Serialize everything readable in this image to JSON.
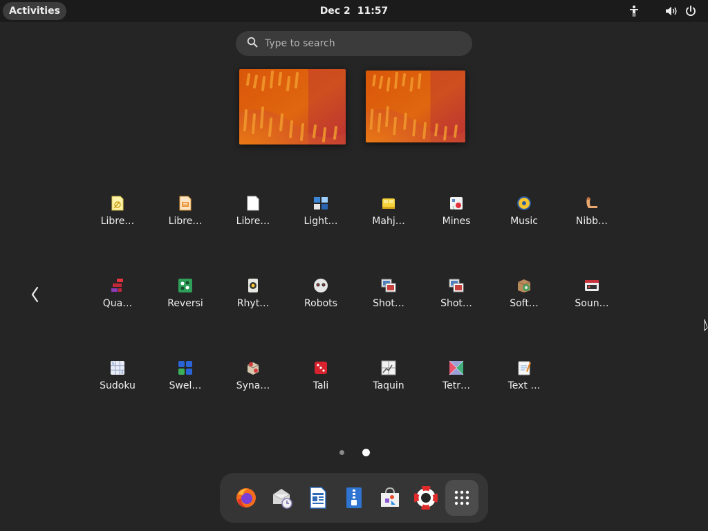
{
  "topbar": {
    "activities_label": "Activities",
    "date": "Dec 2",
    "time": "11:57",
    "tray_icons": [
      "accessibility-icon",
      "volume-icon",
      "power-icon"
    ]
  },
  "search": {
    "placeholder": "Type to search"
  },
  "workspaces": [
    {
      "name": "workspace-1"
    },
    {
      "name": "workspace-2"
    }
  ],
  "app_grid": {
    "rows": [
      [
        {
          "label": "Libre…",
          "icon": "libreoffice-draw-icon"
        },
        {
          "label": "Libre…",
          "icon": "libreoffice-impress-icon"
        },
        {
          "label": "Libre…",
          "icon": "libreoffice-writer-icon"
        },
        {
          "label": "Light…",
          "icon": "lightsoff-icon"
        },
        {
          "label": "Mahj…",
          "icon": "mahjongg-icon"
        },
        {
          "label": "Mines",
          "icon": "mines-icon"
        },
        {
          "label": "Music",
          "icon": "music-icon"
        },
        {
          "label": "Nibb…",
          "icon": "nibbles-icon"
        }
      ],
      [
        {
          "label": "Qua…",
          "icon": "quadrapassel-icon"
        },
        {
          "label": "Reversi",
          "icon": "reversi-icon"
        },
        {
          "label": "Rhyt…",
          "icon": "rhythmbox-icon"
        },
        {
          "label": "Robots",
          "icon": "robots-icon"
        },
        {
          "label": "Shot…",
          "icon": "shotwell-icon"
        },
        {
          "label": "Shot…",
          "icon": "shotwell-viewer-icon"
        },
        {
          "label": "Soft…",
          "icon": "software-properties-icon"
        },
        {
          "label": "Soun…",
          "icon": "sound-recorder-icon"
        }
      ],
      [
        {
          "label": "Sudoku",
          "icon": "sudoku-icon"
        },
        {
          "label": "Swel…",
          "icon": "swell-foop-icon"
        },
        {
          "label": "Syna…",
          "icon": "synaptic-icon"
        },
        {
          "label": "Tali",
          "icon": "tali-icon"
        },
        {
          "label": "Taquin",
          "icon": "taquin-icon"
        },
        {
          "label": "Tetr…",
          "icon": "tetravex-icon"
        },
        {
          "label": "Text …",
          "icon": "text-editor-icon"
        }
      ]
    ]
  },
  "pagination": {
    "pages": 2,
    "current_page": 2
  },
  "dash": {
    "items": [
      {
        "icon": "firefox-icon"
      },
      {
        "icon": "thunderbird-mail-icon"
      },
      {
        "icon": "libreoffice-writer-icon"
      },
      {
        "icon": "text-document-icon"
      },
      {
        "icon": "ubuntu-software-icon"
      },
      {
        "icon": "help-icon"
      },
      {
        "icon": "show-applications-icon"
      }
    ],
    "active_index": 6
  },
  "colors": {
    "background": "#252525",
    "topbar": "#1b1b1b",
    "wallpaper_orange": "#e35d0e",
    "wallpaper_red": "#c3284a"
  }
}
